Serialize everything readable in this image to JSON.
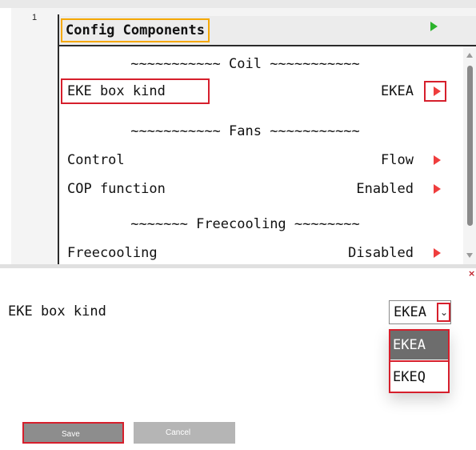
{
  "row_number": "1",
  "header": {
    "title": "Config Components"
  },
  "list": {
    "coil_separator": "~~~~~~~~~~~ Coil ~~~~~~~~~~~",
    "eke_box_kind": {
      "label": "EKE box kind",
      "value": "EKEA"
    },
    "fans_separator": "~~~~~~~~~~~ Fans ~~~~~~~~~~~",
    "control": {
      "label": "Control",
      "value": "Flow"
    },
    "cop_function": {
      "label": "COP function",
      "value": "Enabled"
    },
    "freecooling_separator": "~~~~~~~ Freecooling ~~~~~~~~",
    "freecooling": {
      "label": "Freecooling",
      "value": "Disabled"
    }
  },
  "editor": {
    "close_glyph": "×",
    "field_label": "EKE box kind",
    "selected_value": "EKEA",
    "options": [
      "EKEA",
      "EKEQ"
    ]
  },
  "buttons": {
    "save": "Save",
    "cancel": "Cancel"
  },
  "colors": {
    "highlight_red": "#d61f2c",
    "title_outline_orange": "#f5a800",
    "arrow_red": "#ef3d3d",
    "arrow_green": "#2bb32b"
  },
  "icons": {
    "title_arrow": "play-right-icon",
    "row_arrow": "play-right-icon",
    "dropdown": "chevron-down-icon"
  }
}
